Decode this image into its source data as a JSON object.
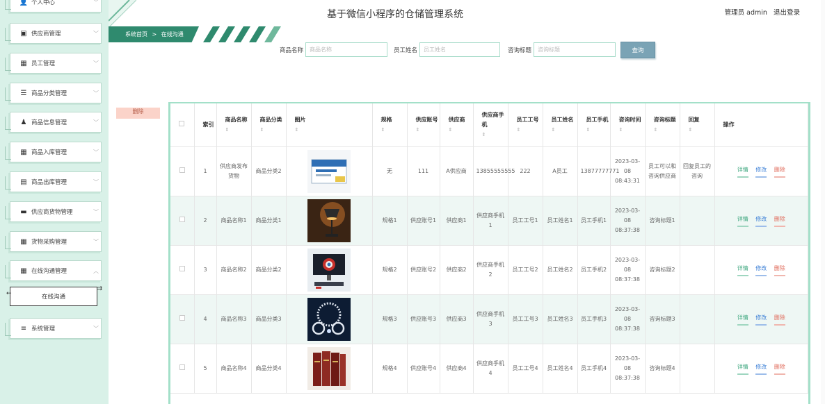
{
  "header": {
    "title": "基于微信小程序的仓储管理系统",
    "user": "管理员 admin",
    "logout": "退出登录"
  },
  "breadcrumb": {
    "home": "系统首页",
    "sep": ">",
    "current": "在线沟通"
  },
  "sidebar": {
    "items": [
      {
        "label": "个人中心",
        "icon": "user-icon"
      },
      {
        "label": "供应商管理",
        "icon": "building-icon"
      },
      {
        "label": "员工管理",
        "icon": "grid-icon"
      },
      {
        "label": "商品分类管理",
        "icon": "list-icon"
      },
      {
        "label": "商品信息管理",
        "icon": "person-icon"
      },
      {
        "label": "商品入库管理",
        "icon": "grid-icon"
      },
      {
        "label": "商品出库管理",
        "icon": "clipboard-icon"
      },
      {
        "label": "供应商货物管理",
        "icon": "briefcase-icon"
      },
      {
        "label": "货物采购管理",
        "icon": "grid-icon"
      },
      {
        "label": "在线沟通管理",
        "icon": "grid-icon"
      },
      {
        "label": "系统管理",
        "icon": "sliders-icon"
      }
    ],
    "active_sub": "在线沟通"
  },
  "search": {
    "fields": [
      {
        "label": "商品名称",
        "placeholder": "商品名称"
      },
      {
        "label": "员工姓名",
        "placeholder": "员工姓名"
      },
      {
        "label": "咨询标题",
        "placeholder": "咨询标题"
      }
    ],
    "button": "查询"
  },
  "bulk_delete": "删除",
  "table": {
    "headers": [
      "",
      "索引",
      "商品名称",
      "商品分类",
      "图片",
      "规格",
      "供应账号",
      "供应商",
      "供应商手机",
      "员工工号",
      "员工姓名",
      "员工手机",
      "咨询时间",
      "咨询标题",
      "回复",
      "操作"
    ],
    "sort_mark": "⇕",
    "actions": {
      "detail": "详情",
      "edit": "修改",
      "delete": "删除"
    },
    "rows": [
      {
        "index": "1",
        "name": "供应商发布货物",
        "category": "商品分类2",
        "image": "medicine-box",
        "spec": "无",
        "account": "111",
        "supplier": "A供应商",
        "supplier_phone": "13855555555",
        "emp_no": "222",
        "emp_name": "A员工",
        "emp_phone": "13877777771",
        "time": "2023-03-08 08:43:31",
        "title": "员工可以和咨询供应商",
        "reply": "回复员工的咨询"
      },
      {
        "index": "2",
        "name": "商品名称1",
        "category": "商品分类1",
        "image": "desk-lamp",
        "spec": "规格1",
        "account": "供应账号1",
        "supplier": "供应商1",
        "supplier_phone": "供应商手机1",
        "emp_no": "员工工号1",
        "emp_name": "员工姓名1",
        "emp_phone": "员工手机1",
        "time": "2023-03-08 08:37:38",
        "title": "咨询标题1",
        "reply": ""
      },
      {
        "index": "3",
        "name": "商品名称2",
        "category": "商品分类2",
        "image": "monitor",
        "spec": "规格2",
        "account": "供应账号2",
        "supplier": "供应商2",
        "supplier_phone": "供应商手机2",
        "emp_no": "员工工号2",
        "emp_name": "员工姓名2",
        "emp_phone": "员工手机2",
        "time": "2023-03-08 08:37:38",
        "title": "咨询标题2",
        "reply": ""
      },
      {
        "index": "4",
        "name": "商品名称3",
        "category": "商品分类3",
        "image": "jewelry",
        "spec": "规格3",
        "account": "供应账号3",
        "supplier": "供应商3",
        "supplier_phone": "供应商手机3",
        "emp_no": "员工工号3",
        "emp_name": "员工姓名3",
        "emp_phone": "员工手机3",
        "time": "2023-03-08 08:37:38",
        "title": "咨询标题3",
        "reply": ""
      },
      {
        "index": "5",
        "name": "商品名称4",
        "category": "商品分类4",
        "image": "books",
        "spec": "规格4",
        "account": "供应账号4",
        "supplier": "供应商4",
        "supplier_phone": "供应商手机4",
        "emp_no": "员工工号4",
        "emp_name": "员工姓名4",
        "emp_phone": "员工手机4",
        "time": "2023-03-08 08:37:38",
        "title": "咨询标题4",
        "reply": ""
      }
    ]
  },
  "colors": {
    "accent": "#2f8a6e",
    "sidebar_bg": "#d9f1e8",
    "table_border": "#a3e0c9",
    "search_button": "#7aa3b5"
  }
}
